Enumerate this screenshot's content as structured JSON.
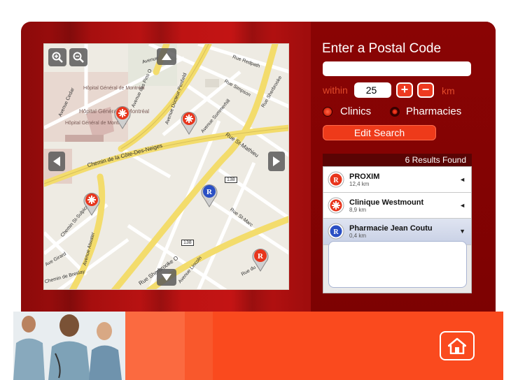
{
  "search": {
    "title": "Enter a Postal Code",
    "postal_value": "",
    "postal_placeholder": "",
    "within_label": "within",
    "distance_value": "25",
    "plus_label": "+",
    "minus_label": "−",
    "unit_label": "km",
    "options": [
      {
        "label": "Clinics",
        "selected": false
      },
      {
        "label": "Pharmacies",
        "selected": true
      }
    ],
    "edit_button": "Edit Search"
  },
  "results": {
    "count_label": "6 Results Found",
    "items": [
      {
        "name": "PROXIM",
        "distance": "12,4 km",
        "type": "pharmacy",
        "expanded": false,
        "arrow": "◄"
      },
      {
        "name": "Clinique Westmount",
        "distance": "8,9 km",
        "type": "clinic",
        "expanded": false,
        "arrow": "◄"
      },
      {
        "name": "Pharmacie Jean Coutu",
        "distance": "0,4 km",
        "type": "pharmacy-selected",
        "expanded": true,
        "arrow": "▼"
      }
    ]
  },
  "map": {
    "zoom_in": "+",
    "zoom_out": "−",
    "labels": {
      "hopital1": "Hôpital Général de Montréal",
      "hopital2": "Hôpital Général de Montréal",
      "hopital3": "Hôpital Général de Montréal",
      "cedar": "Avenue Cedar",
      "pins": "Avenue des Pins O",
      "penfield": "Avenue Docteur-Penfield",
      "redpath": "Rue Redpath",
      "simpson": "Rue Simpson",
      "summerhill": "Avenue Summerhill",
      "cote_neiges": "Chemin de la Côte-Des-Neiges",
      "sherbrooke_e": "Rue Sherbrooke",
      "st_mathieu": "Rue St-Mathieu",
      "st_sulpice": "Chemin St-Sulpice",
      "atwater": "Avenue Atwater",
      "st_marc": "Rue St-Marc",
      "sherbrooke_w": "Rue Sherbrooke O",
      "lincoln": "Avenue Lincoln",
      "du_fort": "Rue du Fort",
      "breslay": "Chemin de Breslay",
      "girard": "Ave Girard",
      "avenue": "Avenue",
      "route1": "138",
      "route2": "138",
      "rue": "Rue"
    }
  },
  "colors": {
    "panel_bg": "#7d0202",
    "accent_red": "#ee3a1a",
    "footer_orange": "#fa4a1e",
    "clinic_pin": "#e8351c",
    "pharmacy_pin": "#2a4fc4"
  },
  "icons": {
    "home": "home-icon",
    "zoom_in": "zoom-in-icon",
    "zoom_out": "zoom-out-icon",
    "pan_up": "arrow-up-icon",
    "pan_down": "arrow-down-icon",
    "pan_left": "arrow-left-icon",
    "pan_right": "arrow-right-icon"
  }
}
